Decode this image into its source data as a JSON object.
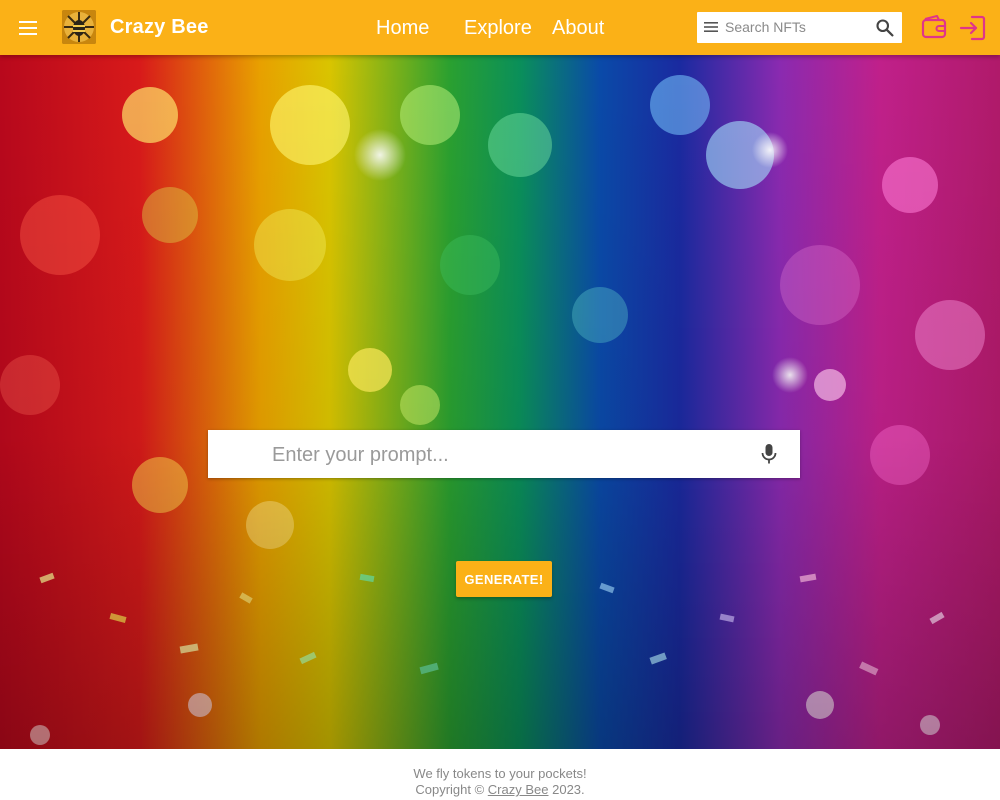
{
  "header": {
    "brand": "Crazy Bee",
    "nav": {
      "home": "Home",
      "explore": "Explore",
      "about": "About"
    },
    "search_placeholder": "Search NFTs",
    "color": "#fbb117",
    "icons": [
      "menu-icon",
      "bee-logo",
      "search-icon",
      "wallet-icon",
      "login-icon"
    ]
  },
  "hero": {
    "prompt_placeholder": "Enter your prompt...",
    "generate_label": "GENERATE!",
    "background": "rainbow glitter photo"
  },
  "footer": {
    "tagline": "We fly tokens to your pockets!",
    "copyright_prefix": "Copyright © ",
    "copyright_link": "Crazy Bee",
    "copyright_year": " 2023."
  }
}
